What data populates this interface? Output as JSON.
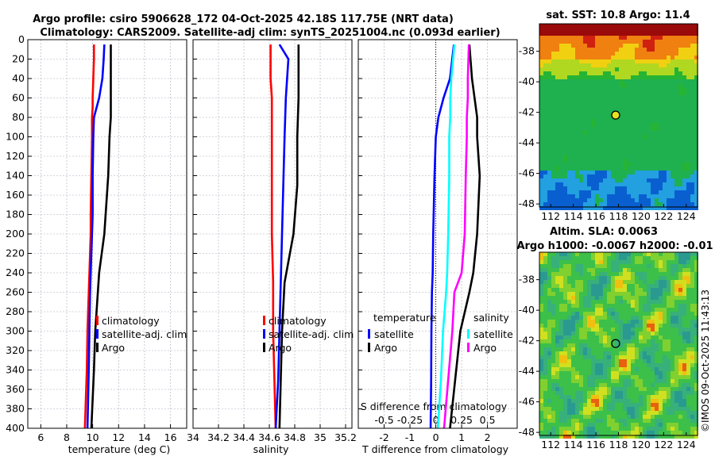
{
  "title_line1": "Argo profile: csiro 5906628_172 04-Oct-2025 42.18S 117.75E (NRT data)",
  "title_line2": "Climatology: CARS2009. Satellite-adj clim: synTS_20251004.nc (0.093d earlier)",
  "timestamp": "©IMOS 09-Oct-2025 11:43:13",
  "colors": {
    "climatology": "#ff0000",
    "satellite": "#0000ff",
    "argo": "#000000",
    "salinity_satellite": "#00ffff",
    "salinity_argo": "#ff00ff"
  },
  "chart_data": [
    {
      "type": "line",
      "xlabel": "temperature (deg C)",
      "ylabel": "",
      "xlim": [
        5,
        17.25
      ],
      "ylim": [
        400,
        0
      ],
      "xticks": [
        6,
        8,
        10,
        12,
        14,
        16
      ],
      "yticks": [
        0,
        20,
        40,
        60,
        80,
        100,
        120,
        140,
        160,
        180,
        200,
        220,
        240,
        260,
        280,
        300,
        320,
        340,
        360,
        380,
        400
      ],
      "grid": true,
      "legend": "bottom-center",
      "depth": [
        5,
        20,
        40,
        60,
        70,
        80,
        100,
        140,
        180,
        200,
        220,
        240,
        260,
        300,
        340,
        400
      ],
      "series": [
        {
          "name": "climatology",
          "color": "#ff0000",
          "values": [
            10.1,
            10.1,
            10.05,
            10.0,
            10.0,
            9.95,
            9.95,
            9.9,
            9.85,
            9.85,
            9.8,
            9.75,
            9.7,
            9.6,
            9.55,
            9.4
          ]
        },
        {
          "name": "satellite-adj. clim",
          "color": "#0000ff",
          "values": [
            10.9,
            10.85,
            10.75,
            10.5,
            10.3,
            10.1,
            10.05,
            10.0,
            10.0,
            9.95,
            9.9,
            9.85,
            9.8,
            9.75,
            9.7,
            9.6
          ]
        },
        {
          "name": "Argo",
          "color": "#000000",
          "values": [
            11.4,
            11.4,
            11.4,
            11.4,
            11.4,
            11.4,
            11.3,
            11.2,
            11.0,
            10.9,
            10.7,
            10.5,
            10.4,
            10.2,
            10.1,
            9.9
          ]
        }
      ]
    },
    {
      "type": "line",
      "xlabel": "salinity",
      "ylabel": "",
      "xlim": [
        34,
        35.25
      ],
      "ylim": [
        400,
        0
      ],
      "xticks": [
        34,
        34.2,
        34.4,
        34.6,
        34.8,
        35,
        35.2
      ],
      "grid": true,
      "legend": "bottom-center",
      "depth": [
        5,
        20,
        40,
        60,
        100,
        150,
        200,
        250,
        300,
        350,
        400
      ],
      "series": [
        {
          "name": "climatology",
          "color": "#ff0000",
          "values": [
            34.61,
            34.61,
            34.61,
            34.62,
            34.62,
            34.62,
            34.62,
            34.63,
            34.63,
            34.64,
            34.65
          ]
        },
        {
          "name": "satellite-adj. clim",
          "color": "#0000ff",
          "values": [
            34.68,
            34.75,
            34.74,
            34.73,
            34.72,
            34.71,
            34.7,
            34.69,
            34.68,
            34.67,
            34.65
          ]
        },
        {
          "name": "Argo",
          "color": "#000000",
          "values": [
            34.83,
            34.83,
            34.83,
            34.83,
            34.82,
            34.82,
            34.79,
            34.72,
            34.7,
            34.69,
            34.68
          ]
        }
      ]
    },
    {
      "type": "line",
      "xlabel": "T difference from climatology",
      "x2label": "S difference from climatology",
      "xlim": [
        -3,
        3.15
      ],
      "ylim": [
        400,
        0
      ],
      "xticks": [
        -2,
        -1,
        0,
        1,
        2
      ],
      "x2ticks": [
        -0.5,
        -0.25,
        0,
        0.25,
        0.5
      ],
      "x2tick_labels": [
        "-0.5",
        "-0.25",
        "0",
        "0.25",
        "0.5"
      ],
      "grid": true,
      "legend_temperature_title": "temperature",
      "legend_salinity_title": "salinity",
      "depth": [
        5,
        40,
        60,
        80,
        100,
        140,
        200,
        240,
        260,
        300,
        350,
        400
      ],
      "series": [
        {
          "name": "satellite",
          "group": "temperature",
          "color": "#0000ff",
          "values": [
            0.7,
            0.55,
            0.3,
            0.1,
            0.0,
            -0.05,
            -0.1,
            -0.12,
            -0.15,
            -0.17,
            -0.18,
            -0.2
          ]
        },
        {
          "name": "Argo",
          "group": "temperature",
          "color": "#000000",
          "values": [
            1.3,
            1.4,
            1.5,
            1.6,
            1.6,
            1.7,
            1.6,
            1.45,
            1.3,
            0.95,
            0.75,
            0.55
          ]
        },
        {
          "name": "satellite",
          "group": "salinity",
          "color": "#00ffff",
          "values": [
            0.18,
            0.15,
            0.14,
            0.14,
            0.13,
            0.13,
            0.12,
            0.11,
            0.1,
            0.07,
            0.05,
            0.02
          ]
        },
        {
          "name": "Argo",
          "group": "salinity",
          "color": "#ff00ff",
          "values": [
            0.32,
            0.31,
            0.31,
            0.3,
            0.3,
            0.29,
            0.28,
            0.25,
            0.18,
            0.16,
            0.12,
            0.08
          ]
        }
      ]
    },
    {
      "type": "heatmap",
      "title": "sat. SST: 10.8 Argo: 11.4",
      "xticks": [
        112,
        114,
        116,
        118,
        120,
        122,
        124
      ],
      "yticks": [
        -38,
        -40,
        -42,
        -44,
        -46,
        -48
      ],
      "xlim": [
        111,
        125
      ],
      "ylim": [
        -48.2,
        -36.2
      ],
      "marker": [
        117.75,
        -42.18
      ]
    },
    {
      "type": "heatmap",
      "title": "Altim. SLA: 0.0063",
      "subtitle": "Argo h1000: -0.0067 h2000: -0.01",
      "xticks": [
        112,
        114,
        116,
        118,
        120,
        122,
        124
      ],
      "yticks": [
        -38,
        -40,
        -42,
        -44,
        -46,
        -48
      ],
      "xlim": [
        111,
        125
      ],
      "ylim": [
        -48.2,
        -36.2
      ],
      "marker": [
        117.75,
        -42.18
      ]
    }
  ]
}
